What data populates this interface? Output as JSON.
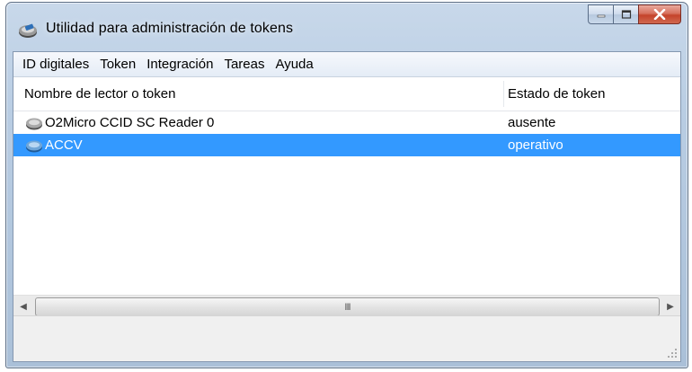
{
  "window": {
    "title": "Utilidad para administración de tokens",
    "app_icon": "token-reader-icon",
    "controls": {
      "minimize": "minimize-icon",
      "maximize": "maximize-icon",
      "close": "close-icon"
    }
  },
  "menu": {
    "items": [
      {
        "label": "ID digitales"
      },
      {
        "label": "Token"
      },
      {
        "label": "Integración"
      },
      {
        "label": "Tareas"
      },
      {
        "label": "Ayuda"
      }
    ]
  },
  "list": {
    "columns": {
      "name": "Nombre de lector o token",
      "status": "Estado de token"
    },
    "rows": [
      {
        "name": "O2Micro CCID SC Reader 0",
        "status": "ausente",
        "icon": "card-reader-icon",
        "selected": false
      },
      {
        "name": "ACCV",
        "status": "operativo",
        "icon": "token-icon",
        "selected": true
      }
    ]
  },
  "scrollbar": {
    "left_arrow": "◀",
    "right_arrow": "▶",
    "thumb_grip": "III"
  },
  "colors": {
    "selection": "#3399ff",
    "title_bar": "#b9cde3",
    "close_button": "#c4432b"
  }
}
